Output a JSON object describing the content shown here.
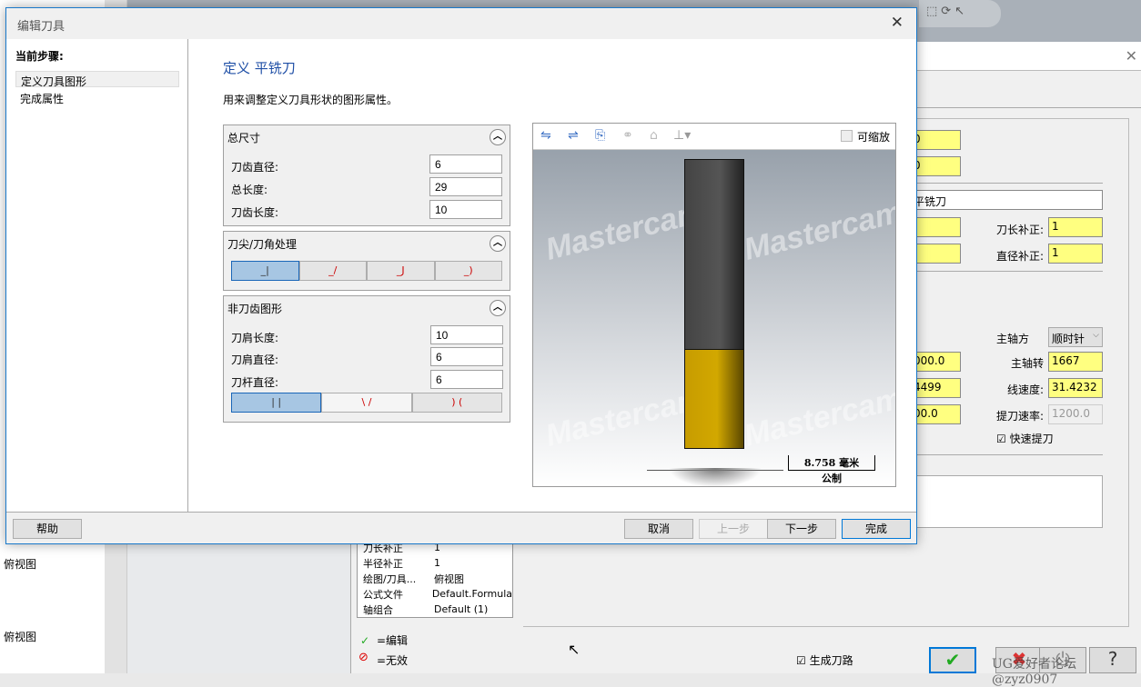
{
  "background": {
    "left_items": [
      "俯视图",
      "俯视图"
    ],
    "right_window": {
      "top_fields": [
        "0",
        "0"
      ],
      "tool_name": "平铣刀",
      "length_offset_label": "刀长补正:",
      "length_offset": "1",
      "dia_offset_label": "直径补正:",
      "dia_offset": "1",
      "spindle_dir_label": "主轴方",
      "spindle_dir": "顺时针",
      "spindle_speed_label": "主轴转",
      "spindle_speed": "1667",
      "surface_speed_label": "线速度:",
      "surface_speed": "31.4232",
      "retract_rate_label": "提刀速率:",
      "retract_rate": "1200.0",
      "left_fields": [
        "000.0",
        "4499",
        "00.0"
      ],
      "rapid_retract_label": "快速提刀",
      "generate_toolpath_label": "生成刀路",
      "watermark": "UG爱好者论坛@zyz0907"
    },
    "props": [
      [
        "刀长补正",
        "1"
      ],
      [
        "半径补正",
        "1"
      ],
      [
        "绘图/刀具...",
        "俯视图"
      ],
      [
        "公式文件",
        "Default.Formula"
      ],
      [
        "轴组合",
        "Default (1)"
      ]
    ],
    "legend": [
      {
        "icon": "check-icon",
        "label": "=编辑"
      },
      {
        "icon": "invalid-icon",
        "label": "=无效"
      }
    ]
  },
  "dialog": {
    "title": "编辑刀具",
    "steps_header": "当前步骤:",
    "steps": [
      "定义刀具图形",
      "完成属性"
    ],
    "heading": "定义 平铣刀",
    "description": "用来调整定义刀具形状的图形属性。",
    "overall": {
      "title": "总尺寸",
      "fields": [
        {
          "label": "刀齿直径:",
          "value": "6"
        },
        {
          "label": "总长度:",
          "value": "29"
        },
        {
          "label": "刀齿长度:",
          "value": "10"
        }
      ]
    },
    "corner": {
      "title": "刀尖/刀角处理",
      "selected": 0
    },
    "nonflute": {
      "title": "非刀齿图形",
      "fields": [
        {
          "label": "刀肩长度:",
          "value": "10"
        },
        {
          "label": "刀肩直径:",
          "value": "6"
        },
        {
          "label": "刀杆直径:",
          "value": "6"
        }
      ],
      "selected": 0
    },
    "preview": {
      "scalable_label": "可缩放",
      "watermark": "Mastercam",
      "dimension": "8.758 毫米",
      "units": "公制",
      "colors": {
        "shank": "#4f4f4f",
        "flute": "#d2a800"
      }
    },
    "buttons": {
      "help": "帮助",
      "cancel": "取消",
      "back": "上一步",
      "next": "下一步",
      "finish": "完成"
    }
  }
}
